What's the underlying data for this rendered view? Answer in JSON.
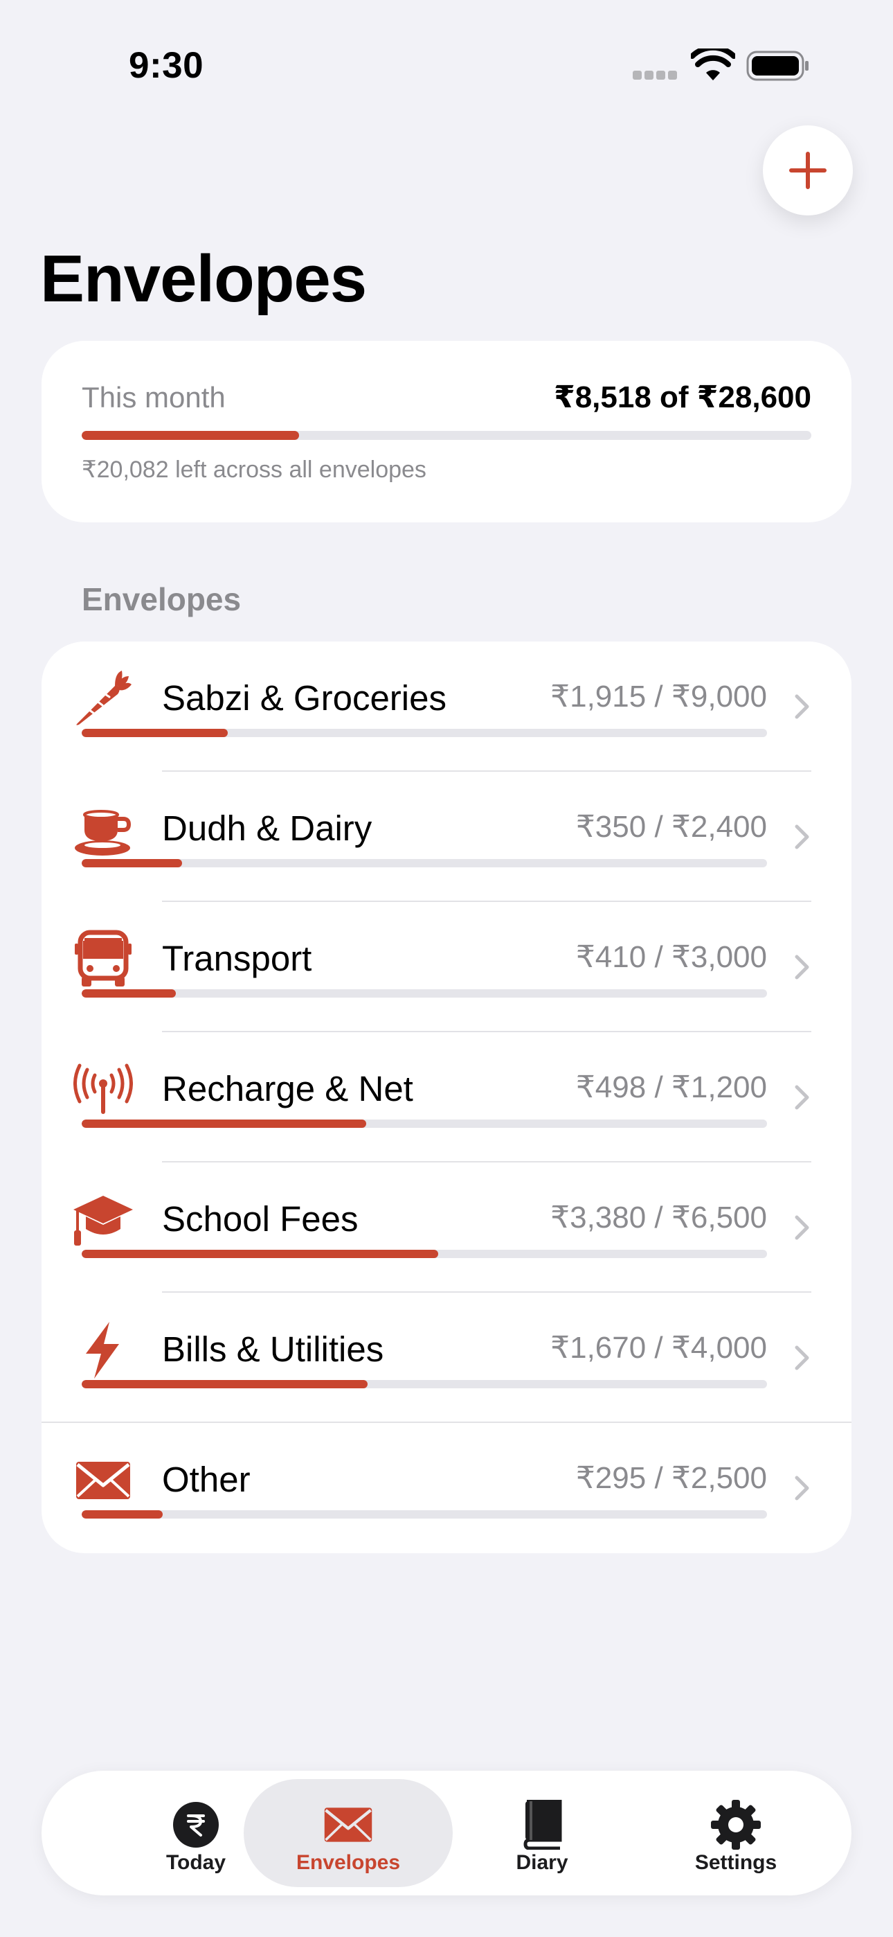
{
  "status_bar": {
    "time": "9:30"
  },
  "header": {
    "title": "Envelopes"
  },
  "summary": {
    "label": "This month",
    "total": "₹8,518 of ₹28,600",
    "progress": 0.298,
    "remaining": "₹20,082 left across all envelopes"
  },
  "section": {
    "title": "Envelopes"
  },
  "envelopes": [
    {
      "name": "Sabzi & Groceries",
      "amount": "₹1,915 / ₹9,000",
      "progress": 0.213,
      "icon": "carrot-icon"
    },
    {
      "name": "Dudh & Dairy",
      "amount": "₹350 / ₹2,400",
      "progress": 0.146,
      "icon": "cup-icon"
    },
    {
      "name": "Transport",
      "amount": "₹410 / ₹3,000",
      "progress": 0.137,
      "icon": "bus-icon"
    },
    {
      "name": "Recharge & Net",
      "amount": "₹498 / ₹1,200",
      "progress": 0.415,
      "icon": "antenna-icon"
    },
    {
      "name": "School Fees",
      "amount": "₹3,380 / ₹6,500",
      "progress": 0.52,
      "icon": "graduation-cap-icon"
    },
    {
      "name": "Bills & Utilities",
      "amount": "₹1,670 / ₹4,000",
      "progress": 0.4175,
      "icon": "bolt-icon"
    },
    {
      "name": "Other",
      "amount": "₹295 / ₹2,500",
      "progress": 0.118,
      "icon": "envelope-icon"
    }
  ],
  "tabs": [
    {
      "label": "Today",
      "icon": "rupee-icon",
      "active": false
    },
    {
      "label": "Envelopes",
      "icon": "envelope-icon",
      "active": true
    },
    {
      "label": "Diary",
      "icon": "book-icon",
      "active": false
    },
    {
      "label": "Settings",
      "icon": "gear-icon",
      "active": false
    }
  ],
  "colors": {
    "accent": "#c8452f",
    "background": "#f2f2f7",
    "track": "#e5e5ea",
    "secondary_text": "#8a8a8e"
  }
}
